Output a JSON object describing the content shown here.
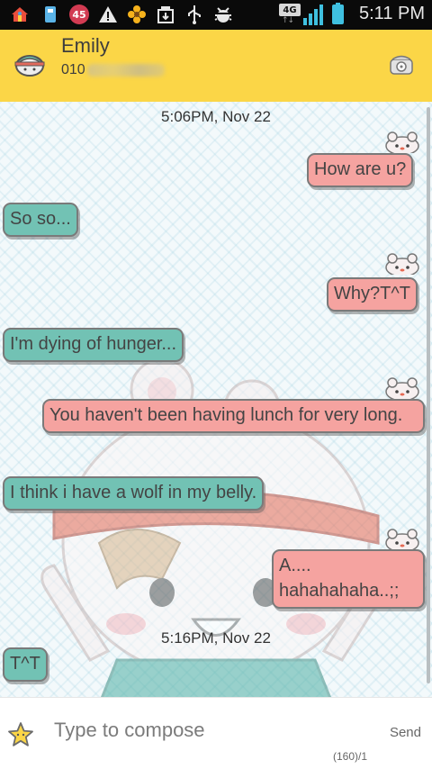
{
  "status_bar": {
    "notification_count": "45",
    "network": "4G",
    "time": "5:11 PM",
    "icons": [
      "home-icon",
      "usb-storage-icon",
      "notification-count-icon",
      "warning-icon",
      "flower-icon",
      "download-icon",
      "usb-icon",
      "android-debug-icon",
      "signal-icon",
      "battery-charging-icon"
    ]
  },
  "header": {
    "contact_name": "Emily",
    "contact_number": "010",
    "background_color": "#fbd647"
  },
  "conversation": {
    "timestamps": [
      "5:06PM, Nov 22",
      "5:16PM, Nov 22"
    ],
    "messages": [
      {
        "direction": "out",
        "text": "How are u?"
      },
      {
        "direction": "in",
        "text": "So so..."
      },
      {
        "direction": "out",
        "text": "Why?T^T"
      },
      {
        "direction": "in",
        "text": "I'm dying of hunger..."
      },
      {
        "direction": "out",
        "text": "You haven't been having lunch for very long."
      },
      {
        "direction": "in",
        "text": "I think i have a wolf in my belly."
      },
      {
        "direction": "out",
        "text": "A....\nhahahahaha..;;"
      },
      {
        "direction": "in",
        "text": "T^T"
      }
    ],
    "colors": {
      "outgoing": "#f5a3a0",
      "incoming": "#72c2b4"
    }
  },
  "compose": {
    "placeholder": "Type to compose",
    "send_label": "Send",
    "counter": "(160)/1"
  }
}
